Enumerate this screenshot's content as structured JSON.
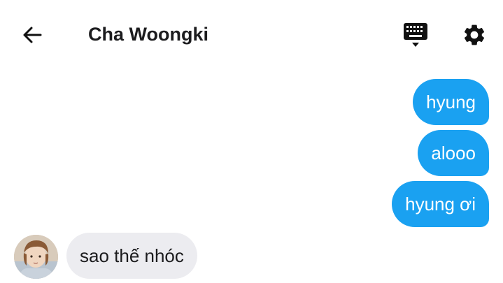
{
  "header": {
    "back_icon": "arrow-left-icon",
    "title": "Cha Woongki",
    "keyboard_icon": "keyboard-icon",
    "settings_icon": "gear-icon"
  },
  "messages": [
    {
      "direction": "outgoing",
      "text": "hyung"
    },
    {
      "direction": "outgoing",
      "text": "alooo"
    },
    {
      "direction": "outgoing",
      "text": "hyung ơi"
    },
    {
      "direction": "incoming",
      "text": "sao thế nhóc"
    }
  ],
  "colors": {
    "outgoing_bubble": "#1aa1f1",
    "incoming_bubble": "#ececf0",
    "title_text": "#1c1c1e"
  }
}
